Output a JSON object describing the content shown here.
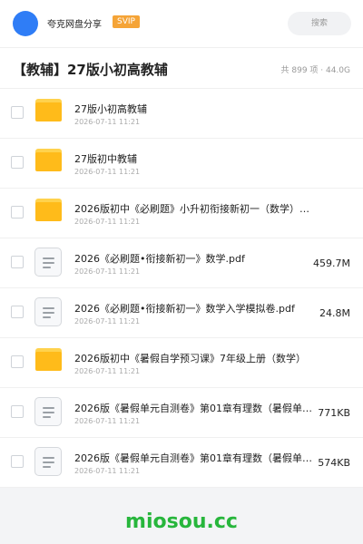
{
  "app": {
    "share_title": "夸克网盘分享",
    "svip_badge": "SVIP",
    "search_label": "搜索"
  },
  "folder": {
    "title": "【教辅】27版小初高教辅",
    "stats": "共 899 项 · 44.0G"
  },
  "items": [
    {
      "type": "folder",
      "name": "27版小初高教辅",
      "date": "2026-07-11 11:21",
      "size": ""
    },
    {
      "type": "folder",
      "name": "27版初中教辅",
      "date": "2026-07-11 11:21",
      "size": ""
    },
    {
      "type": "folder",
      "name": "2026版初中《必刷题》小升初衔接新初一（数学）初…",
      "date": "2026-07-11 11:21",
      "size": ""
    },
    {
      "type": "file",
      "name": "2026《必刷题•衔接新初一》数学.pdf",
      "date": "2026-07-11 11:21",
      "size": "459.7M"
    },
    {
      "type": "file",
      "name": "2026《必刷题•衔接新初一》数学入学模拟卷.pdf",
      "date": "2026-07-11 11:21",
      "size": "24.8M"
    },
    {
      "type": "folder",
      "name": "2026版初中《暑假自学预习课》7年级上册（数学）",
      "date": "2026-07-11 11:21",
      "size": ""
    },
    {
      "type": "file",
      "name": "2026版《暑假单元自测卷》第01章有理数（暑假单…",
      "date": "2026-07-11 11:21",
      "size": "771KB"
    },
    {
      "type": "file",
      "name": "2026版《暑假单元自测卷》第01章有理数（暑假单…",
      "date": "2026-07-11 11:21",
      "size": "574KB"
    }
  ],
  "watermark": "miosou.cc",
  "colors": {
    "accent": "#2f7df6",
    "svip": "#f5a437",
    "folder": "#ffbb1a",
    "watermark": "#27b63c"
  }
}
